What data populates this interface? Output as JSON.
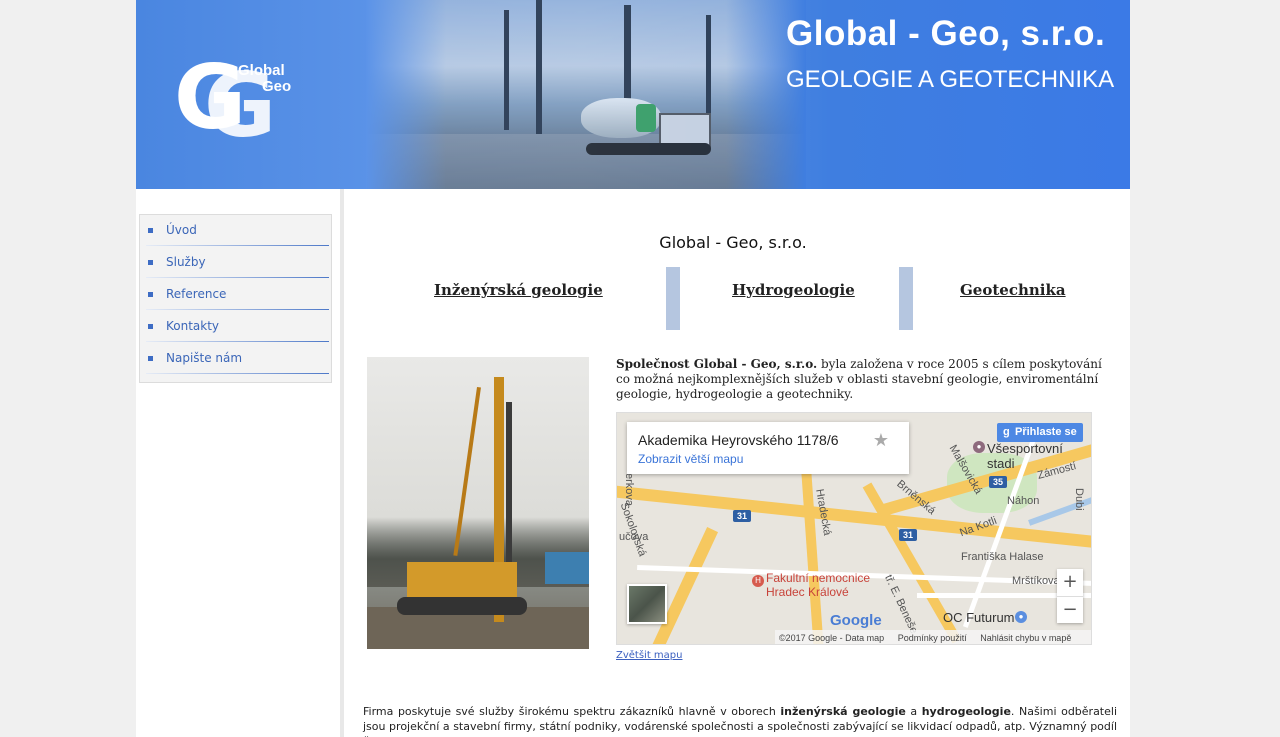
{
  "header": {
    "title": "Global - Geo, s.r.o.",
    "subtitle": "GEOLOGIE A GEOTECHNIKA",
    "logo": {
      "mark": "GG",
      "line1": "Global",
      "line2": "Geo"
    }
  },
  "menu": {
    "items": [
      {
        "label": "Úvod"
      },
      {
        "label": "Služby"
      },
      {
        "label": "Reference"
      },
      {
        "label": "Kontakty"
      },
      {
        "label": "Napište nám"
      }
    ]
  },
  "main": {
    "page_title": "Global - Geo, s.r.o.",
    "tabs": [
      {
        "label": "Inženýrská geologie"
      },
      {
        "label": "Hydrogeologie"
      },
      {
        "label": "Geotechnika"
      }
    ],
    "intro": {
      "company": "Společnost Global - Geo, s.r.o.",
      "text": " byla založena v roce 2005 s cílem poskytování co možná nejkomplexnějších služeb v oblasti stavební geologie, enviromentální geologie, hydrogeologie a geotechniky."
    },
    "map": {
      "address": "Akademika Heyrovského 1178/6",
      "larger_map_link": "Zobrazit větší mapu",
      "signin": "Přihlaste se",
      "labels": {
        "stadium": "Všesportovní stadi",
        "hospital_1": "Fakultní nemocnice",
        "hospital_2": "Hradec Králové",
        "futurum": "OC Futurum",
        "malsovicka": "Malšovická",
        "brnenska": "Brněnská",
        "hradecka": "Hradecká",
        "nakotli": "Na Kotli",
        "zamosti": "Zámostí",
        "nahon": "Náhon",
        "frantiska": "Františka Halase",
        "mrstikova": "Mrštíkova",
        "sokolovska": "Sokolovská",
        "ucova": "učova",
        "erkova": "erkova",
        "benese": "tř. E. Beneše",
        "dubi": "Dubi"
      },
      "shields": [
        "35",
        "31",
        "31",
        "35"
      ],
      "zoom_in": "+",
      "zoom_out": "−",
      "google": "Google",
      "attribution": [
        "©2017 Google - Data map",
        "Podmínky použití",
        "Nahlásit chybu v mapě"
      ]
    },
    "enlarge_map": "Zvětšit mapu",
    "body": {
      "p1_a": "Firma poskytuje své služby širokému spektru zákazníků hlavně v oborech ",
      "p1_b": "inženýrská geologie",
      "p1_c": " a ",
      "p1_d": "hydrogeologie",
      "p1_e": ". Našimi odběrateli jsou projekční a stavební firmy, státní podniky, vodárenské společnosti a společnosti zabývající se likvidací odpadů, atp. Významný podíl činnosti"
    }
  },
  "colors": {
    "header_blue": "#4a86e0",
    "menu_link": "#3b66b8",
    "tab_separator": "#b5c6e0"
  }
}
